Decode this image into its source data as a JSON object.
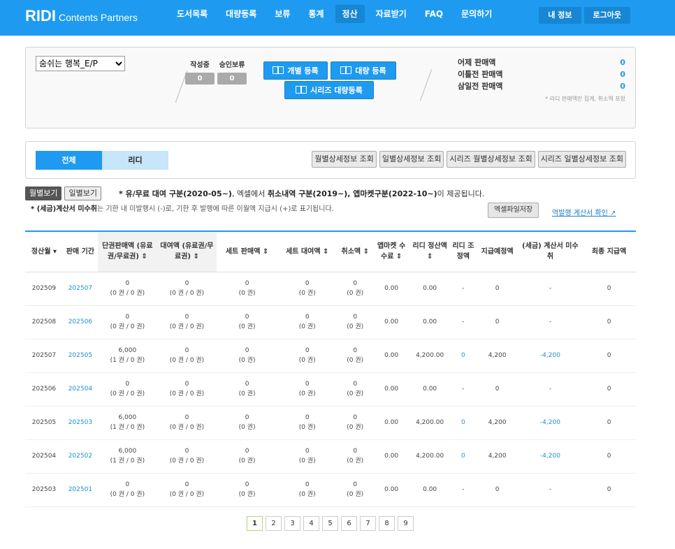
{
  "header": {
    "logo_brand": "RIDI",
    "logo_sub": "Contents Partners",
    "nav": [
      {
        "label": "도서목록",
        "active": false
      },
      {
        "label": "대량등록",
        "active": false
      },
      {
        "label": "보류",
        "active": false
      },
      {
        "label": "통계",
        "active": false
      },
      {
        "label": "정산",
        "active": true
      },
      {
        "label": "자료받기",
        "active": false
      },
      {
        "label": "FAQ",
        "active": false
      },
      {
        "label": "문의하기",
        "active": false
      }
    ],
    "my_info": "내 정보",
    "logout": "로그아웃"
  },
  "summary": {
    "book_select": "숨쉬는 행복_E/P",
    "writing_label": "작성중",
    "writing_value": "0",
    "pending_label": "승인보류",
    "pending_value": "0",
    "btn_single": "개별 등록",
    "btn_bulk": "대량 등록",
    "btn_series": "시리즈 대량등록",
    "sales": [
      {
        "label": "어제 판매액",
        "value": "0"
      },
      {
        "label": "이틀전 판매액",
        "value": "0"
      },
      {
        "label": "삼일전 판매액",
        "value": "0"
      }
    ],
    "sales_note": "* 리디 판매액만 집계, 취소액 포함"
  },
  "filter": {
    "tab_all": "전체",
    "tab_ridi": "리디",
    "buttons": [
      "월별상세정보 조회",
      "일별상세정보 조회",
      "시리즈 월별상세정보 조회",
      "시리즈 일별상세정보 조회"
    ]
  },
  "view": {
    "monthly": "월별보기",
    "daily": "일별보기",
    "notice1_a": "* 유/무료 대여 구분(2020-05~)",
    "notice1_b": ", 엑셀에서 ",
    "notice1_c": "취소내역 구분(2019~), 앱마켓구분(2022-10~)",
    "notice1_d": "이 제공됩니다.",
    "notice2_a": "* (세금)계산서 미수취",
    "notice2_b": "는 기한 내 미발행시 (-)로, 기한 후 발행에 따른 이월액 지급시 (+)로 표기됩니다.",
    "excel": "엑셀파일저장",
    "inv_link": "역발행 계산서 확인 ↗"
  },
  "table": {
    "headers": [
      "정산월 ▾",
      "판매 기간",
      "단권판매액 (유료권/무료권) ⇕",
      "대여액 (유료권/무료권) ⇕",
      "세트 판매액 ⇕",
      "세트 대여액 ⇕",
      "취소액 ⇕",
      "앱마켓 수수료 ⇕",
      "리디 정산액 ⇕",
      "리디 조정액",
      "지급예정액",
      "(세금) 계산서 미수취",
      "최종 지급액"
    ],
    "rows": [
      {
        "month": "202509",
        "period": "202507",
        "single": "0",
        "single_sub": "(0 권 / 0 권)",
        "rent": "0",
        "rent_sub": "(0 권 / 0 권)",
        "set_sale": "0",
        "set_sale_sub": "(0 권)",
        "set_rent": "0",
        "set_rent_sub": "(0 권)",
        "cancel": "0",
        "cancel_sub": "(0 권)",
        "fee": "0.00",
        "ridi": "0.00",
        "adjust": "-",
        "expected": "0",
        "tax": "-",
        "final": "0"
      },
      {
        "month": "202508",
        "period": "202506",
        "single": "0",
        "single_sub": "(0 권 / 0 권)",
        "rent": "0",
        "rent_sub": "(0 권 / 0 권)",
        "set_sale": "0",
        "set_sale_sub": "(0 권)",
        "set_rent": "0",
        "set_rent_sub": "(0 권)",
        "cancel": "0",
        "cancel_sub": "(0 권)",
        "fee": "0.00",
        "ridi": "0.00",
        "adjust": "-",
        "expected": "0",
        "tax": "-",
        "final": "0"
      },
      {
        "month": "202507",
        "period": "202505",
        "single": "6,000",
        "single_sub": "(1 권 / 0 권)",
        "rent": "0",
        "rent_sub": "(0 권 / 0 권)",
        "set_sale": "0",
        "set_sale_sub": "(0 권)",
        "set_rent": "0",
        "set_rent_sub": "(0 권)",
        "cancel": "0",
        "cancel_sub": "(0 권)",
        "fee": "0.00",
        "ridi": "4,200.00",
        "adjust": "0",
        "expected": "4,200",
        "tax": "-4,200",
        "final": "0"
      },
      {
        "month": "202506",
        "period": "202504",
        "single": "0",
        "single_sub": "(0 권 / 0 권)",
        "rent": "0",
        "rent_sub": "(0 권 / 0 권)",
        "set_sale": "0",
        "set_sale_sub": "(0 권)",
        "set_rent": "0",
        "set_rent_sub": "(0 권)",
        "cancel": "0",
        "cancel_sub": "(0 권)",
        "fee": "0.00",
        "ridi": "0.00",
        "adjust": "-",
        "expected": "0",
        "tax": "-",
        "final": "0"
      },
      {
        "month": "202505",
        "period": "202503",
        "single": "6,000",
        "single_sub": "(1 권 / 0 권)",
        "rent": "0",
        "rent_sub": "(0 권 / 0 권)",
        "set_sale": "0",
        "set_sale_sub": "(0 권)",
        "set_rent": "0",
        "set_rent_sub": "(0 권)",
        "cancel": "0",
        "cancel_sub": "(0 권)",
        "fee": "0.00",
        "ridi": "4,200.00",
        "adjust": "0",
        "expected": "4,200",
        "tax": "-4,200",
        "final": "0"
      },
      {
        "month": "202504",
        "period": "202502",
        "single": "6,000",
        "single_sub": "(1 권 / 0 권)",
        "rent": "0",
        "rent_sub": "(0 권 / 0 권)",
        "set_sale": "0",
        "set_sale_sub": "(0 권)",
        "set_rent": "0",
        "set_rent_sub": "(0 권)",
        "cancel": "0",
        "cancel_sub": "(0 권)",
        "fee": "0.00",
        "ridi": "4,200.00",
        "adjust": "0",
        "expected": "4,200",
        "tax": "-4,200",
        "final": "0"
      },
      {
        "month": "202503",
        "period": "202501",
        "single": "0",
        "single_sub": "(0 권 / 0 권)",
        "rent": "0",
        "rent_sub": "(0 권 / 0 권)",
        "set_sale": "0",
        "set_sale_sub": "(0 권)",
        "set_rent": "0",
        "set_rent_sub": "(0 권)",
        "cancel": "0",
        "cancel_sub": "(0 권)",
        "fee": "0.00",
        "ridi": "0.00",
        "adjust": "-",
        "expected": "0",
        "tax": "-",
        "final": "0"
      }
    ]
  },
  "pagination": {
    "pages": [
      "1",
      "2",
      "3",
      "4",
      "5",
      "6",
      "7",
      "8",
      "9"
    ],
    "current": "1"
  }
}
